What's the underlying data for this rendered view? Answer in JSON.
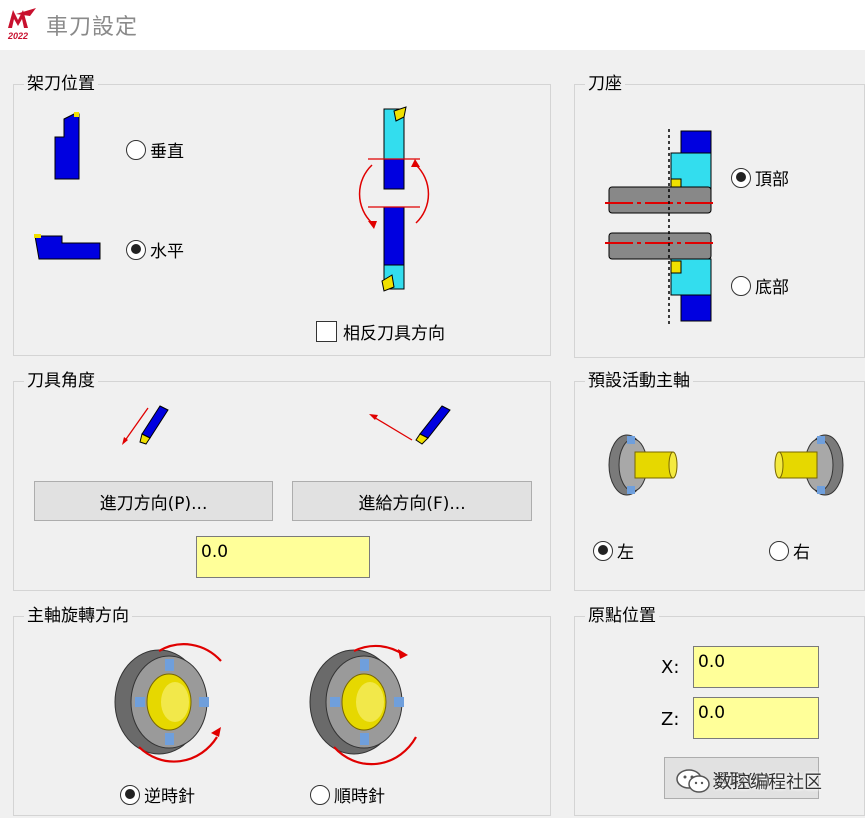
{
  "window": {
    "title": "車刀設定",
    "logo_year": "2022"
  },
  "tool_position": {
    "legend": "架刀位置",
    "vertical_label": "垂直",
    "horizontal_label": "水平",
    "selected": "horizontal",
    "reverse_label": "相反刀具方向",
    "reverse_checked": false
  },
  "tool_holder": {
    "legend": "刀座",
    "top_label": "頂部",
    "bottom_label": "底部",
    "selected": "top"
  },
  "tool_angle": {
    "legend": "刀具角度",
    "plunge_button": "進刀方向(P)...",
    "feed_button": "進給方向(F)...",
    "angle_value": "0.0"
  },
  "default_spindle": {
    "legend": "預設活動主軸",
    "left_label": "左",
    "right_label": "右",
    "selected": "left"
  },
  "spindle_direction": {
    "legend": "主軸旋轉方向",
    "ccw_label": "逆時針",
    "cw_label": "順時針",
    "selected": "ccw"
  },
  "origin": {
    "legend": "原點位置",
    "x_label": "X:",
    "x_value": "0.0",
    "z_label": "Z:",
    "z_value": "0.0",
    "select_button": "選取(S)"
  },
  "watermark": {
    "text": "数控编程社区"
  },
  "colors": {
    "tool_blue": "#0000e0",
    "insert_yellow": "#f0e000",
    "highlight_cyan": "#33ddee",
    "arrow_red": "#e00000",
    "field_yellow": "#ffff99"
  }
}
